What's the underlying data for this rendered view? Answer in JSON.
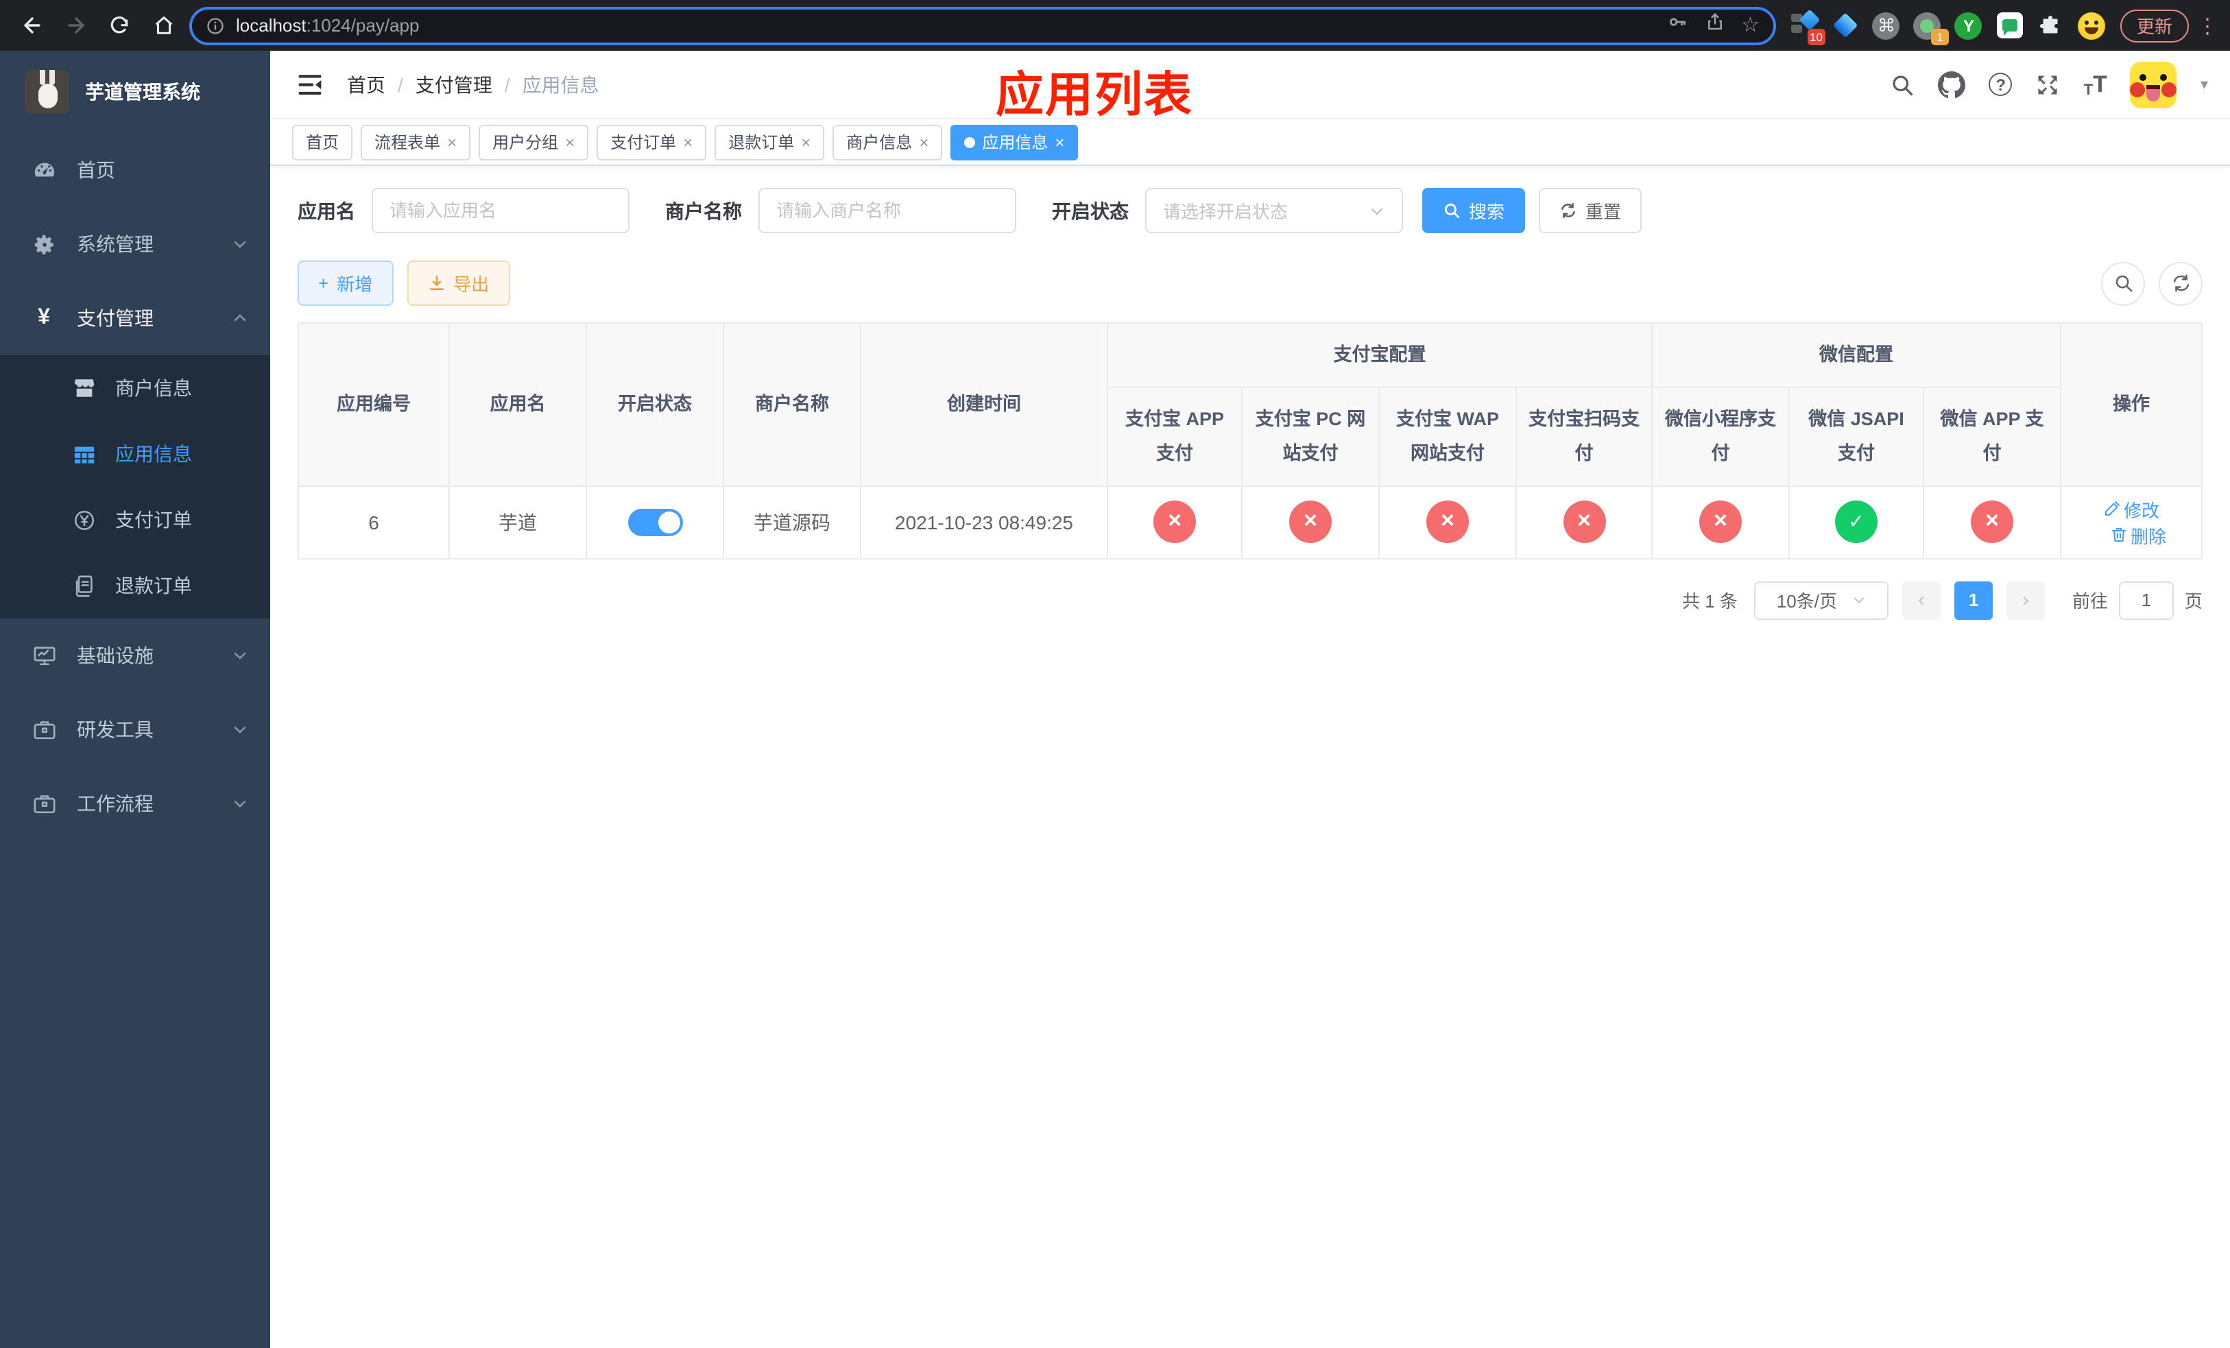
{
  "browser": {
    "url": {
      "host": "localhost",
      "path": ":1024/pay/app"
    },
    "update_button": "更新",
    "ext_badge_grid": "10",
    "ext_badge_record": "1",
    "ext_y_label": "Y"
  },
  "icons": {
    "close": "×",
    "plus": "+",
    "yen": "¥",
    "star": "☆",
    "command": "⌘",
    "kebab": "⋮",
    "help": "?",
    "caret_down": "▾",
    "prev": "‹",
    "next": "›",
    "font_small": "T",
    "font_large": "T"
  },
  "sidebar": {
    "title": "芋道管理系统",
    "home": "首页",
    "system": "系统管理",
    "payment": "支付管理",
    "merchant": "商户信息",
    "app_info": "应用信息",
    "pay_order": "支付订单",
    "refund_order": "退款订单",
    "infra": "基础设施",
    "dev_tools": "研发工具",
    "workflow": "工作流程"
  },
  "navbar": {
    "breadcrumb": {
      "home": "首页",
      "section": "支付管理",
      "current": "应用信息"
    }
  },
  "annotation": {
    "title": "应用列表"
  },
  "tabs": {
    "items": [
      {
        "label": "首页"
      },
      {
        "label": "流程表单"
      },
      {
        "label": "用户分组"
      },
      {
        "label": "支付订单"
      },
      {
        "label": "退款订单"
      },
      {
        "label": "商户信息"
      },
      {
        "label": "应用信息"
      }
    ]
  },
  "filters": {
    "app_name_label": "应用名",
    "app_name_placeholder": "请输入应用名",
    "merchant_label": "商户名称",
    "merchant_placeholder": "请输入商户名称",
    "status_label": "开启状态",
    "status_placeholder": "请选择开启状态",
    "search_label": "搜索",
    "reset_label": "重置"
  },
  "toolbar": {
    "add_label": "新增",
    "export_label": "导出"
  },
  "table": {
    "headers": {
      "app_id": "应用编号",
      "app_name": "应用名",
      "status": "开启状态",
      "merchant": "商户名称",
      "created": "创建时间",
      "group_alipay": "支付宝配置",
      "group_wechat": "微信配置",
      "alipay_app": "支付宝 APP 支付",
      "alipay_pc": "支付宝 PC 网站支付",
      "alipay_wap": "支付宝 WAP 网站支付",
      "alipay_scan": "支付宝扫码支付",
      "wx_mini": "微信小程序支付",
      "wx_jsapi": "微信 JSAPI 支付",
      "wx_app": "微信 APP 支付",
      "actions": "操作"
    },
    "row": {
      "id": "6",
      "name": "芋道",
      "status_toggle": "on",
      "merchant": "芋道源码",
      "created": "2021-10-23 08:49:25",
      "statuses": [
        "no",
        "no",
        "no",
        "no",
        "no",
        "yes",
        "no"
      ],
      "edit_label": "修改",
      "delete_label": "删除"
    }
  },
  "pagination": {
    "total": "共 1 条",
    "page_size": "10条/页",
    "current_page": "1",
    "goto_label": "前往",
    "goto_value": "1",
    "page_suffix": "页"
  },
  "colors": {
    "accent": "#409eff",
    "success": "#13ce66",
    "danger": "#f56c6c",
    "warning": "#e6a23c",
    "annotation_red": "#ff2000",
    "sidebar_bg": "#304156",
    "submenu_bg": "#1f2d3d"
  }
}
